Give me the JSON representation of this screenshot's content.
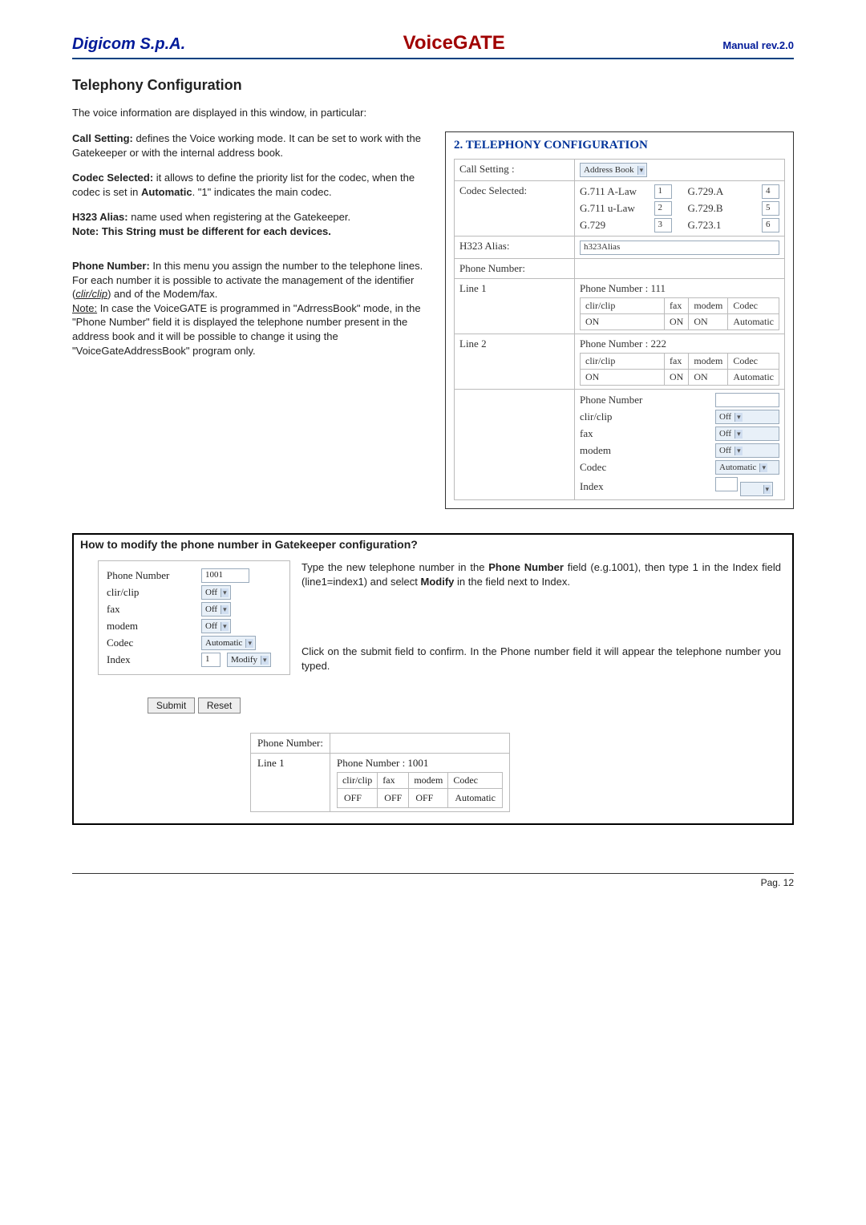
{
  "header": {
    "brand": "Digicom S.p.A.",
    "title": "VoiceGATE",
    "manual": "Manual rev.2.0"
  },
  "section_title": "Telephony Configuration",
  "intro": "The voice information are displayed in this window, in particular:",
  "left": {
    "p1a": "Call Setting:",
    "p1b": " defines the Voice working mode. It can be set to work with the Gatekeeper or with the internal address book.",
    "p2a": "Codec Selected:",
    "p2b": " it allows to define the priority list for the codec, when the codec is set in ",
    "p2c": "Automatic",
    "p2d": ". \"1\" indicates the main codec.",
    "p3a": "H323 Alias:",
    "p3b": " name used when registering at the Gatekeeper.",
    "p3c": "Note: This String must be different for each devices.",
    "p4a": "Phone Number:",
    "p4b": " In this menu you assign the number to the telephone lines. For each number it is possible to activate the management of the identifier (",
    "p4c": "clir/clip",
    "p4d": ") and of the Modem/fax.",
    "p4e": "Note:",
    "p4f": " In case the VoiceGATE is programmed in \"AdrressBook\" mode, in the \"Phone Number\" field it is displayed the telephone number present in the address book and it will be possible to change it using the \"VoiceGateAddressBook\" program only."
  },
  "cfg": {
    "title": "2. TELEPHONY CONFIGURATION",
    "call_setting_label": "Call Setting :",
    "call_setting_value": "Address Book",
    "codec_selected_label": "Codec Selected:",
    "codec": {
      "r1a": "G.711 A-Law",
      "r1av": "1",
      "r1b": "G.729.A",
      "r1bv": "4",
      "r2a": "G.711 u-Law",
      "r2av": "2",
      "r2b": "G.729.B",
      "r2bv": "5",
      "r3a": "G.729",
      "r3av": "3",
      "r3b": "G.723.1",
      "r3bv": "6"
    },
    "h323_label": "H323 Alias:",
    "h323_value": "h323Alias",
    "phone_number_label": "Phone Number:",
    "line1": {
      "label": "Line 1",
      "pn_label": "Phone Number : 111",
      "h_clirclip": "clir/clip",
      "h_fax": "fax",
      "h_modem": "modem",
      "h_codec": "Codec",
      "v_clirclip": "ON",
      "v_fax": "ON",
      "v_modem": "ON",
      "v_codec": "Automatic"
    },
    "line2": {
      "label": "Line 2",
      "pn_label": "Phone Number : 222",
      "h_clirclip": "clir/clip",
      "h_fax": "fax",
      "h_modem": "modem",
      "h_codec": "Codec",
      "v_clirclip": "ON",
      "v_fax": "ON",
      "v_modem": "ON",
      "v_codec": "Automatic"
    },
    "form": {
      "pn_label": "Phone Number",
      "clirclip": "clir/clip",
      "clirclip_v": "Off",
      "fax": "fax",
      "fax_v": "Off",
      "modem": "modem",
      "modem_v": "Off",
      "codec": "Codec",
      "codec_v": "Automatic",
      "index": "Index",
      "index_v": ""
    }
  },
  "howto": {
    "title": "How to modify the phone number in Gatekeeper configuration?",
    "form": {
      "pn_label": "Phone Number",
      "pn_value": "1001",
      "clirclip": "clir/clip",
      "clirclip_v": "Off",
      "fax": "fax",
      "fax_v": "Off",
      "modem": "modem",
      "modem_v": "Off",
      "codec": "Codec",
      "codec_v": "Automatic",
      "index": "Index",
      "index_v": "1",
      "index_sel": "Modify"
    },
    "text1a": "Type the new telephone number in the ",
    "text1b": "Phone Number",
    "text1c": " field (e.g.1001), then type 1 in the Index field (line1=index1) and select ",
    "text1d": "Modify",
    "text1e": " in the field next to Index.",
    "submit": "Submit",
    "reset": "Reset",
    "text2": "Click on the submit field to confirm. In the Phone number field it will appear the telephone number you typed.",
    "table": {
      "pn_label": "Phone Number:",
      "line1_label": "Line 1",
      "pn_val_label": "Phone Number : 1001",
      "h_clirclip": "clir/clip",
      "h_fax": "fax",
      "h_modem": "modem",
      "h_codec": "Codec",
      "v_clirclip": "OFF",
      "v_fax": "OFF",
      "v_modem": "OFF",
      "v_codec": "Automatic"
    }
  },
  "footer": {
    "page": "Pag. 12"
  }
}
